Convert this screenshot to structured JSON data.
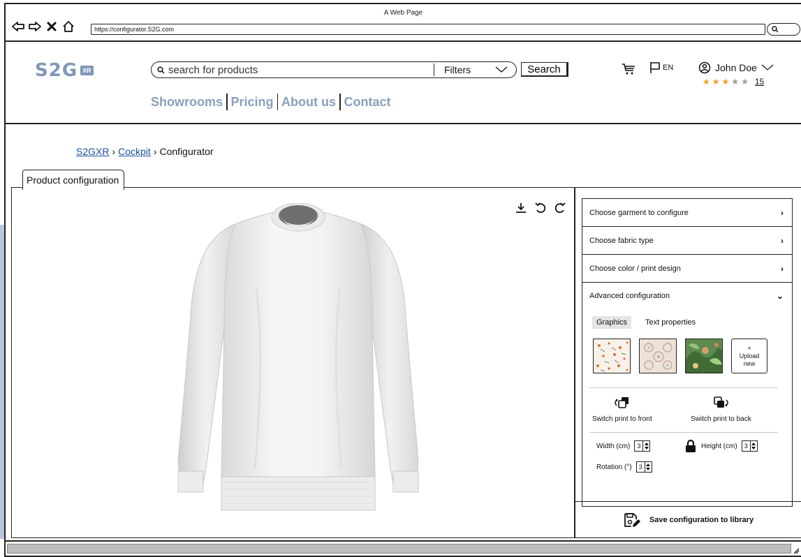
{
  "window": {
    "title": "A Web Page",
    "url": "https://configurator.S2G.com"
  },
  "header": {
    "logo_text": "S2G",
    "logo_badge": "XR",
    "search_placeholder": "search for products",
    "filters_label": "Filters",
    "search_button": "Search",
    "language": "EN",
    "user_name": "John Doe",
    "rating": {
      "value": 3,
      "max": 5,
      "count": "15"
    },
    "nav": [
      "Showrooms",
      "Pricing",
      "About us",
      "Contact"
    ],
    "colors": {
      "accent": "#8aa0bd",
      "star_on": "#f0a020",
      "star_off": "#9a9a9a"
    }
  },
  "breadcrumb": {
    "items": [
      "S2GXR",
      "Cockpit",
      "Configurator"
    ],
    "separator": "›"
  },
  "tab_label": "Product configuration",
  "sidebar": {
    "items": [
      "Choose garment to configure",
      "Choose fabric type",
      "Choose color / print design",
      "Advanced configuration"
    ],
    "advanced": {
      "tabs": [
        "Graphics",
        "Text properties"
      ],
      "upload_plus": "+",
      "upload_label": "Upload new",
      "switch_front": "Switch print to front",
      "switch_back": "Switch print to back",
      "width_label": "Width (cm)",
      "width_value": "3",
      "height_label": "Height (cm)",
      "height_value": "3",
      "rotation_label": "Rotation (°)",
      "rotation_value": "3"
    },
    "save_label": "Save configuration to library"
  }
}
